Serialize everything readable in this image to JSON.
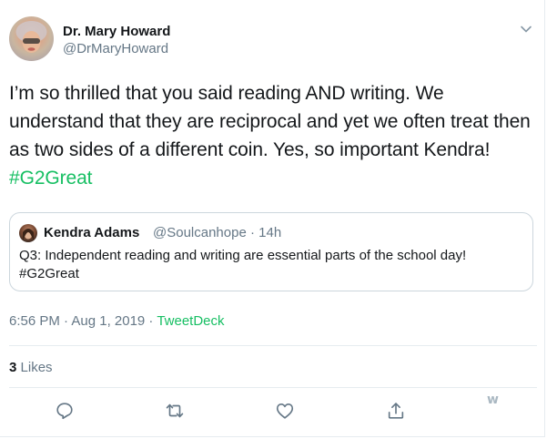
{
  "author": {
    "name": "Dr. Mary Howard",
    "handle": "@DrMaryHoward"
  },
  "tweet": {
    "text": "I’m so thrilled that you said reading AND writing. We understand that they are reciprocal and yet we often treat then as two sides of a different coin. Yes, so important Kendra! ",
    "hashtag": "#G2Great"
  },
  "quoted": {
    "name": "Kendra Adams",
    "meta": "@Soulcanhope · 14h",
    "text": "Q3: Independent reading and writing are essential parts of the school day! #G2Great"
  },
  "timestamp": {
    "time": "6:56 PM · Aug 1, 2019 · ",
    "source": "TweetDeck"
  },
  "stats": {
    "likes_count": "3",
    "likes_label": "Likes"
  },
  "icons": {
    "reply": "reply-icon",
    "retweet": "retweet-icon",
    "like": "like-icon",
    "share": "share-icon",
    "caret": "chevron-down-icon"
  },
  "watermark": "w",
  "colors": {
    "text": "#14171a",
    "secondary": "#657786",
    "hashtag": "#17bf63",
    "border": "#e6ecf0"
  }
}
